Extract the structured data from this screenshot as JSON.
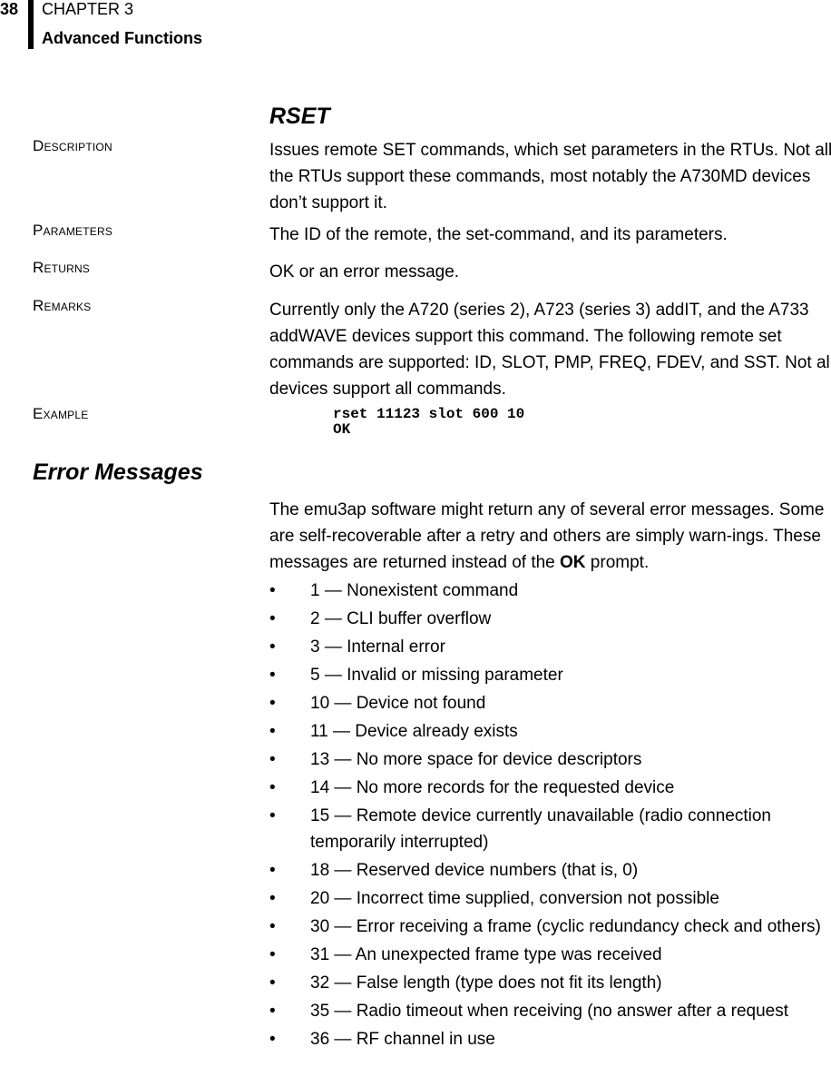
{
  "header": {
    "page_number": "38",
    "chapter": "CHAPTER 3",
    "chapter_title": "Advanced Functions"
  },
  "command": {
    "title": "RSET",
    "rows": [
      {
        "label": "Description",
        "text": "Issues remote SET commands, which set parameters in the RTUs. Not all the RTUs support these commands, most notably the A730MD devices don’t support it."
      },
      {
        "label": "Parameters",
        "text": "The ID of the remote, the set-command, and its parameters."
      },
      {
        "label": "Returns",
        "text": "OK or an error message."
      },
      {
        "label": "Remarks",
        "text": "Currently only the A720 (series 2), A723 (series 3) addIT, and the A733 addWAVE devices support this command. The following remote set commands are supported: ID, SLOT, PMP, FREQ, FDEV, and SST. Not all devices support all commands."
      },
      {
        "label": "Example",
        "code": "rset 11123 slot 600 10\nOK"
      }
    ]
  },
  "errors": {
    "title": "Error Messages",
    "intro_before": "The emu3ap software might return any of several error messages. Some are self-recoverable after a retry and others are simply warn-ings. These messages are returned instead of the ",
    "intro_bold": "OK",
    "intro_after": " prompt.",
    "bullet": "•",
    "items": [
      "1 — Nonexistent command",
      "2 — CLI buffer overflow",
      "3 — Internal error",
      "5 — Invalid or missing parameter",
      "10 — Device not found",
      "11 — Device already exists",
      "13 — No more space for device descriptors",
      "14 — No more records for the requested device",
      "15 — Remote device currently unavailable (radio connection temporarily interrupted)",
      "18 — Reserved device numbers (that is, 0)",
      "20 — Incorrect time supplied, conversion not possible",
      "30 — Error receiving a frame (cyclic redundancy check and others)",
      "31 — An unexpected frame type was received",
      "32 — False length (type does not fit its length)",
      "35 — Radio timeout when receiving (no answer after a request",
      "36 — RF channel in use"
    ]
  }
}
